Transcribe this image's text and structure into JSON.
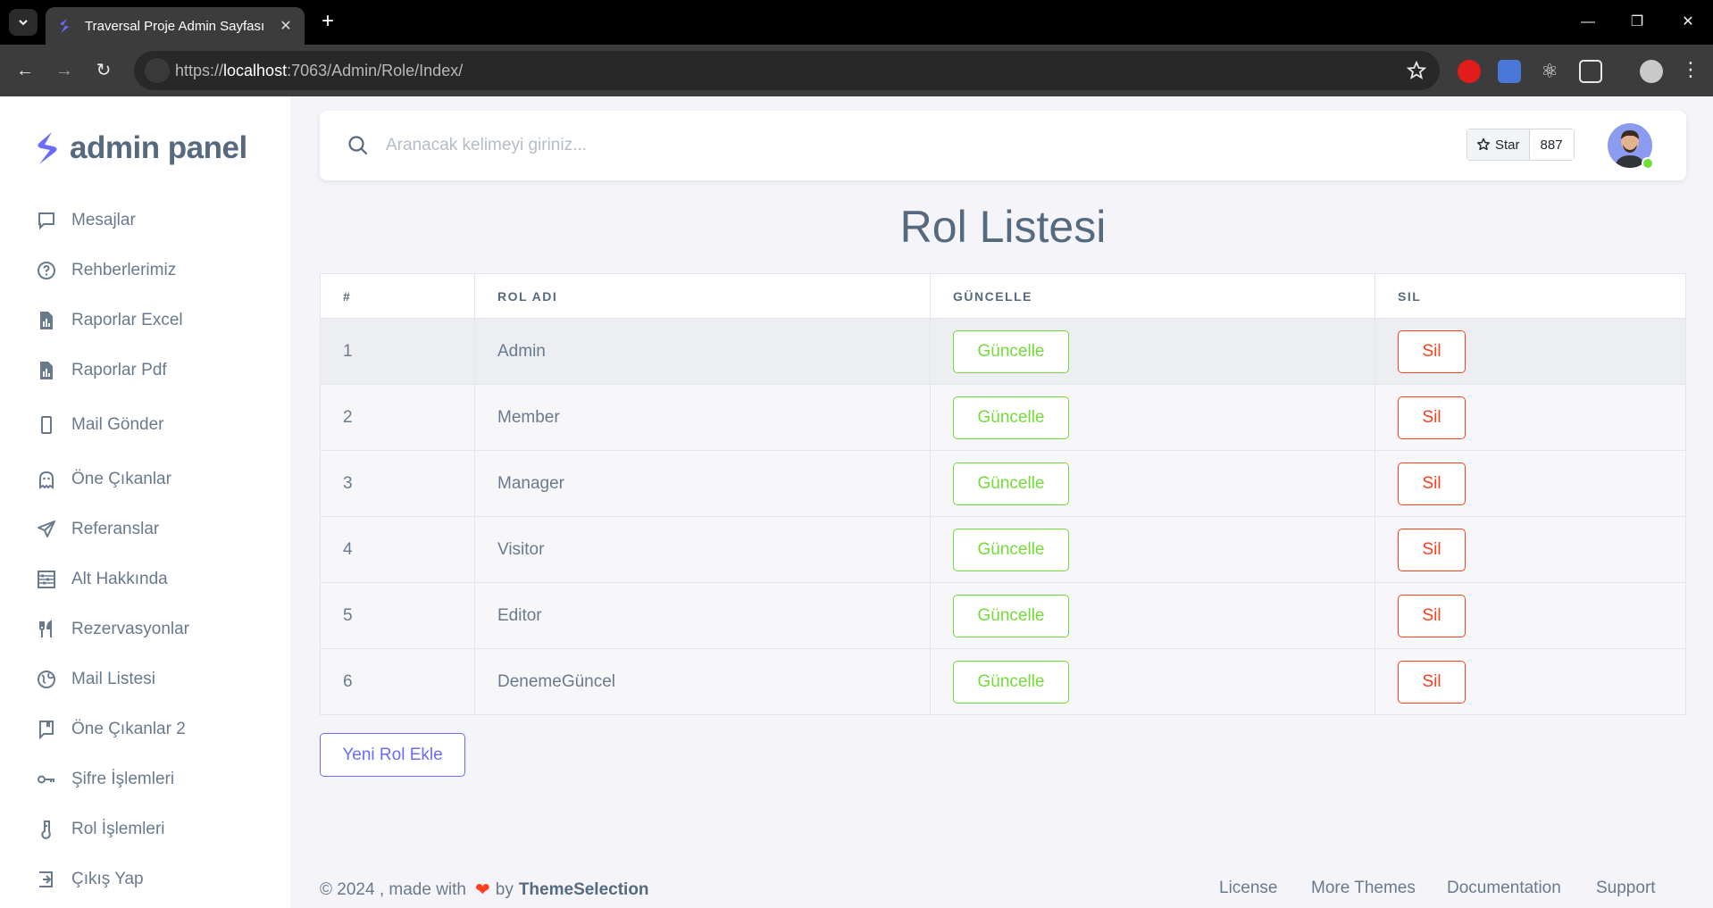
{
  "browser": {
    "tab_title": "Traversal Proje Admin Sayfası",
    "url_prefix": "https://",
    "url_host": "localhost",
    "url_rest": ":7063/Admin/Role/Index/"
  },
  "sidebar": {
    "brand": "admin panel",
    "items": [
      {
        "label": "Mesajlar",
        "icon": "message-square-icon"
      },
      {
        "label": "Rehberlerimiz",
        "icon": "help-circle-icon"
      },
      {
        "label": "Raporlar Excel",
        "icon": "file-report-icon"
      },
      {
        "label": "Raporlar Pdf",
        "icon": "file-report-icon"
      },
      {
        "label": "Mail Gönder",
        "icon": "mobile-icon"
      },
      {
        "label": "Öne Çıkanlar",
        "icon": "ghost-icon"
      },
      {
        "label": "Referanslar",
        "icon": "send-icon"
      },
      {
        "label": "Alt Hakkında",
        "icon": "abacus-icon"
      },
      {
        "label": "Rezervasyonlar",
        "icon": "restaurant-icon"
      },
      {
        "label": "Mail Listesi",
        "icon": "globe-icon"
      },
      {
        "label": "Öne Çıkanlar 2",
        "icon": "book-bookmark-icon"
      },
      {
        "label": "Şifre İşlemleri",
        "icon": "key-icon"
      },
      {
        "label": "Rol İşlemleri",
        "icon": "test-tube-icon"
      },
      {
        "label": "Çıkış Yap",
        "icon": "log-out-icon"
      }
    ]
  },
  "navbar": {
    "search_placeholder": "Aranacak kelimeyi giriniz...",
    "star_label": "Star",
    "star_count": "887"
  },
  "page": {
    "title": "Rol Listesi",
    "add_button": "Yeni Rol Ekle"
  },
  "table": {
    "headers": [
      "#",
      "ROL ADI",
      "GÜNCELLE",
      "SIL"
    ],
    "update_label": "Güncelle",
    "delete_label": "Sil",
    "rows": [
      {
        "id": "1",
        "name": "Admin"
      },
      {
        "id": "2",
        "name": "Member"
      },
      {
        "id": "3",
        "name": "Manager"
      },
      {
        "id": "4",
        "name": "Visitor"
      },
      {
        "id": "5",
        "name": "Editor"
      },
      {
        "id": "6",
        "name": "DenemeGüncel"
      }
    ]
  },
  "footer": {
    "copyright": "© 2024 , made with",
    "by": "by",
    "brand": "ThemeSelection",
    "links": [
      "License",
      "More Themes",
      "Documentation",
      "Support"
    ]
  },
  "colors": {
    "success": "#71dd37",
    "danger": "#ff3e1d",
    "primary": "#696cff"
  }
}
